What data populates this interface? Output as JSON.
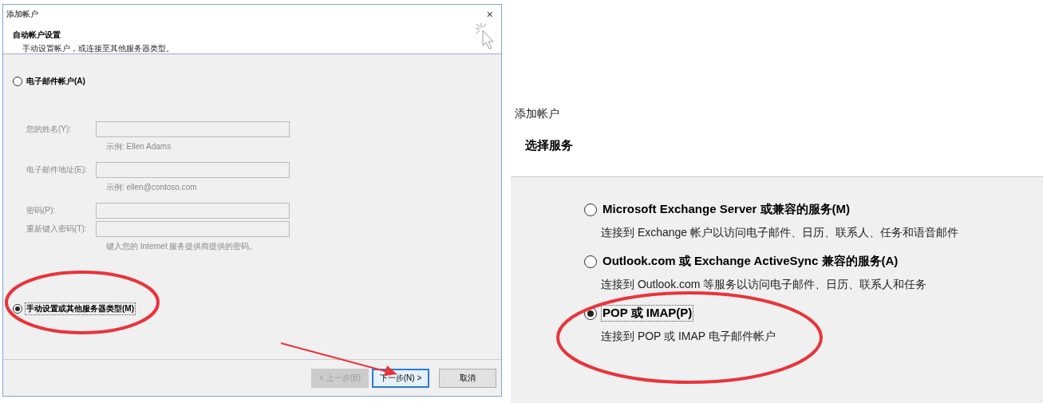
{
  "left_dialog": {
    "title": "添加帐户",
    "close_glyph": "×",
    "header": {
      "title": "自动帐户设置",
      "subtitle": "手动设置帐户，或连接至其他服务器类型。"
    },
    "options": [
      {
        "label": "电子邮件帐户(A)",
        "selected": false,
        "circled": false
      },
      {
        "label": "手动设置或其他服务器类型(M)",
        "selected": true,
        "circled": true
      }
    ],
    "fields": [
      {
        "label": "您的姓名(Y):",
        "hint": "示例: Ellen Adams",
        "disabled": true
      },
      {
        "label": "电子邮件地址(E):",
        "hint": "示例: ellen@contoso.com",
        "disabled": true
      },
      {
        "label": "密码(P):",
        "disabled": true
      },
      {
        "label": "重新键入密码(T):",
        "hint": "键入您的 Internet 服务提供商提供的密码。",
        "disabled": true
      }
    ],
    "buttons": [
      {
        "label": "< 上一步(B)",
        "disabled": true,
        "default": false,
        "arrow_pointed": false
      },
      {
        "label": "下一步(N) >",
        "disabled": false,
        "default": true,
        "arrow_pointed": true
      },
      {
        "label": "取消",
        "disabled": false,
        "default": false,
        "arrow_pointed": false
      }
    ]
  },
  "right_panel": {
    "title": "添加帐户",
    "heading": "选择服务",
    "options": [
      {
        "label": "Microsoft Exchange Server 或兼容的服务(M)",
        "description": "连接到 Exchange 帐户以访问电子邮件、日历、联系人、任务和语音邮件",
        "selected": false,
        "circled": false
      },
      {
        "label": "Outlook.com 或 Exchange ActiveSync 兼容的服务(A)",
        "description": "连接到 Outlook.com 等服务以访问电子邮件、日历、联系人和任务",
        "selected": false,
        "circled": false
      },
      {
        "label": "POP 或 IMAP(P)",
        "description": "连接到 POP 或 IMAP 电子邮件帐户",
        "selected": true,
        "circled": true
      }
    ]
  }
}
